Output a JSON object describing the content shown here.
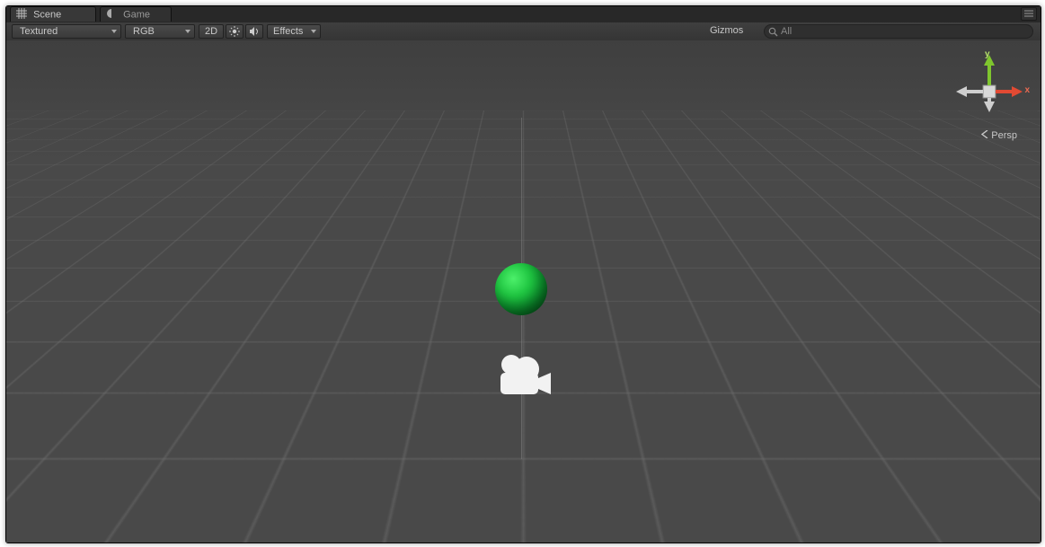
{
  "tabs": {
    "scene": "Scene",
    "game": "Game"
  },
  "toolbar": {
    "shading": "Textured",
    "rendermode": "RGB",
    "twoD": "2D",
    "effects": "Effects",
    "gizmos": "Gizmos",
    "search_placeholder": "All"
  },
  "viewport": {
    "projection_label": "Persp",
    "axis_labels": {
      "x": "x",
      "y": "y"
    }
  },
  "colors": {
    "sphere": "#1fc541",
    "axis_x": "#e24a33",
    "axis_y": "#8bcf3a",
    "axis_z": "#4a8be2",
    "icon": "#f4f4f4"
  }
}
